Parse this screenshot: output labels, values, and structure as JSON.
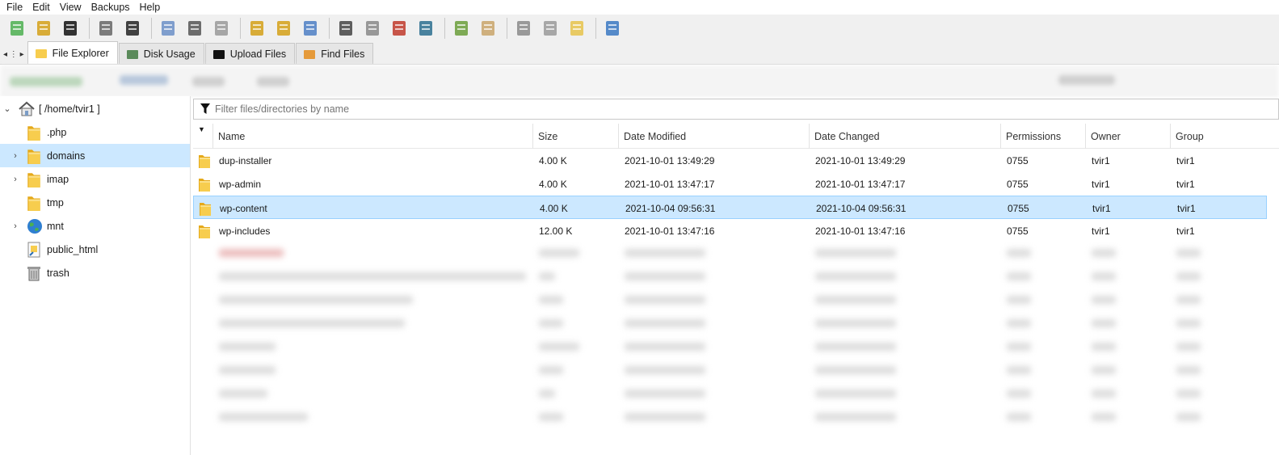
{
  "menu": [
    "File",
    "Edit",
    "View",
    "Backups",
    "Help"
  ],
  "toolbar_icons": [
    "new-file-icon",
    "add-folder-icon",
    "upload-icon",
    "search-icon",
    "select-all-icon",
    "copy-icon",
    "cut-icon",
    "paste-icon",
    "move-folder-icon",
    "copy-folder-icon",
    "move-to-icon",
    "permissions-lock-icon",
    "terminal-icon",
    "delete-file-icon",
    "trash-icon",
    "extract-icon",
    "compress-icon",
    "download-icon",
    "view-icon",
    "edit-icon",
    "checklist-icon"
  ],
  "tabs": [
    {
      "label": "File Explorer",
      "icon": "folder-open-icon",
      "active": true
    },
    {
      "label": "Disk Usage",
      "icon": "disk-usage-icon",
      "active": false
    },
    {
      "label": "Upload Files",
      "icon": "upload-icon",
      "active": false
    },
    {
      "label": "Find Files",
      "icon": "find-files-icon",
      "active": false
    }
  ],
  "tree": {
    "root": "[ /home/tvir1 ]",
    "items": [
      {
        "label": ".php",
        "icon": "folder-icon",
        "expandable": false,
        "selected": false
      },
      {
        "label": "domains",
        "icon": "folder-icon",
        "expandable": true,
        "selected": true
      },
      {
        "label": "imap",
        "icon": "folder-icon",
        "expandable": true,
        "selected": false
      },
      {
        "label": "tmp",
        "icon": "folder-icon",
        "expandable": false,
        "selected": false
      },
      {
        "label": "mnt",
        "icon": "globe-icon",
        "expandable": true,
        "selected": false
      },
      {
        "label": "public_html",
        "icon": "shortcut-icon",
        "expandable": false,
        "selected": false
      },
      {
        "label": "trash",
        "icon": "trash-icon",
        "expandable": false,
        "selected": false
      }
    ]
  },
  "filter": {
    "placeholder": "Filter files/directories by name",
    "value": ""
  },
  "columns": [
    "Name",
    "Size",
    "Date Modified",
    "Date Changed",
    "Permissions",
    "Owner",
    "Group"
  ],
  "rows": [
    {
      "name": "dup-installer",
      "size": "4.00 K",
      "modified": "2021-10-01 13:49:29",
      "changed": "2021-10-01 13:49:29",
      "perms": "0755",
      "owner": "tvir1",
      "group": "tvir1",
      "selected": false
    },
    {
      "name": "wp-admin",
      "size": "4.00 K",
      "modified": "2021-10-01 13:47:17",
      "changed": "2021-10-01 13:47:17",
      "perms": "0755",
      "owner": "tvir1",
      "group": "tvir1",
      "selected": false
    },
    {
      "name": "wp-content",
      "size": "4.00 K",
      "modified": "2021-10-04 09:56:31",
      "changed": "2021-10-04 09:56:31",
      "perms": "0755",
      "owner": "tvir1",
      "group": "tvir1",
      "selected": true
    },
    {
      "name": "wp-includes",
      "size": "12.00 K",
      "modified": "2021-10-01 13:47:16",
      "changed": "2021-10-01 13:47:16",
      "perms": "0755",
      "owner": "tvir1",
      "group": "tvir1",
      "selected": false
    }
  ],
  "colors": {
    "selection": "#cce8ff",
    "folder": "#f4c542",
    "accent": "#0078d7"
  }
}
